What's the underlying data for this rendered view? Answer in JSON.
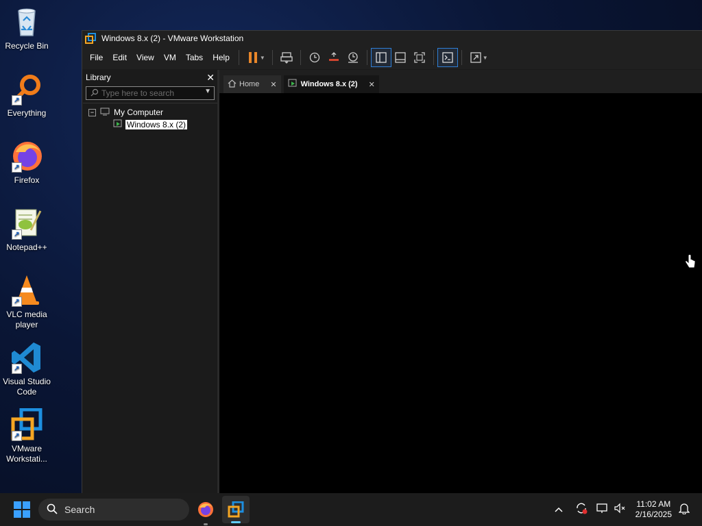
{
  "desktop": {
    "icons": [
      {
        "label": "Recycle Bin",
        "icon": "recycle-bin-icon"
      },
      {
        "label": "Everything",
        "icon": "everything-search-icon"
      },
      {
        "label": "Firefox",
        "icon": "firefox-icon"
      },
      {
        "label": "Notepad++",
        "icon": "notepad-plus-plus-icon"
      },
      {
        "label": "VLC media player",
        "icon": "vlc-icon"
      },
      {
        "label": "Visual Studio Code",
        "icon": "vscode-icon"
      },
      {
        "label": "VMware Workstati...",
        "icon": "vmware-workstation-icon"
      }
    ]
  },
  "window": {
    "title": "Windows 8.x (2) - VMware Workstation",
    "menu": [
      "File",
      "Edit",
      "View",
      "VM",
      "Tabs",
      "Help"
    ],
    "library": {
      "title": "Library",
      "search_placeholder": "Type here to search",
      "tree": {
        "root": "My Computer",
        "children": [
          "Windows 8.x (2)"
        ]
      }
    },
    "tabs": [
      {
        "label": "Home",
        "active": false
      },
      {
        "label": "Windows 8.x (2)",
        "active": true
      }
    ]
  },
  "taskbar": {
    "search_label": "Search",
    "time": "11:02 AM",
    "date": "2/16/2025"
  },
  "colors": {
    "accent": "#2f7fd6",
    "pause_orange": "#e8862a",
    "vmware_orange": "#f5a623",
    "vmware_blue": "#1d8fe0"
  }
}
